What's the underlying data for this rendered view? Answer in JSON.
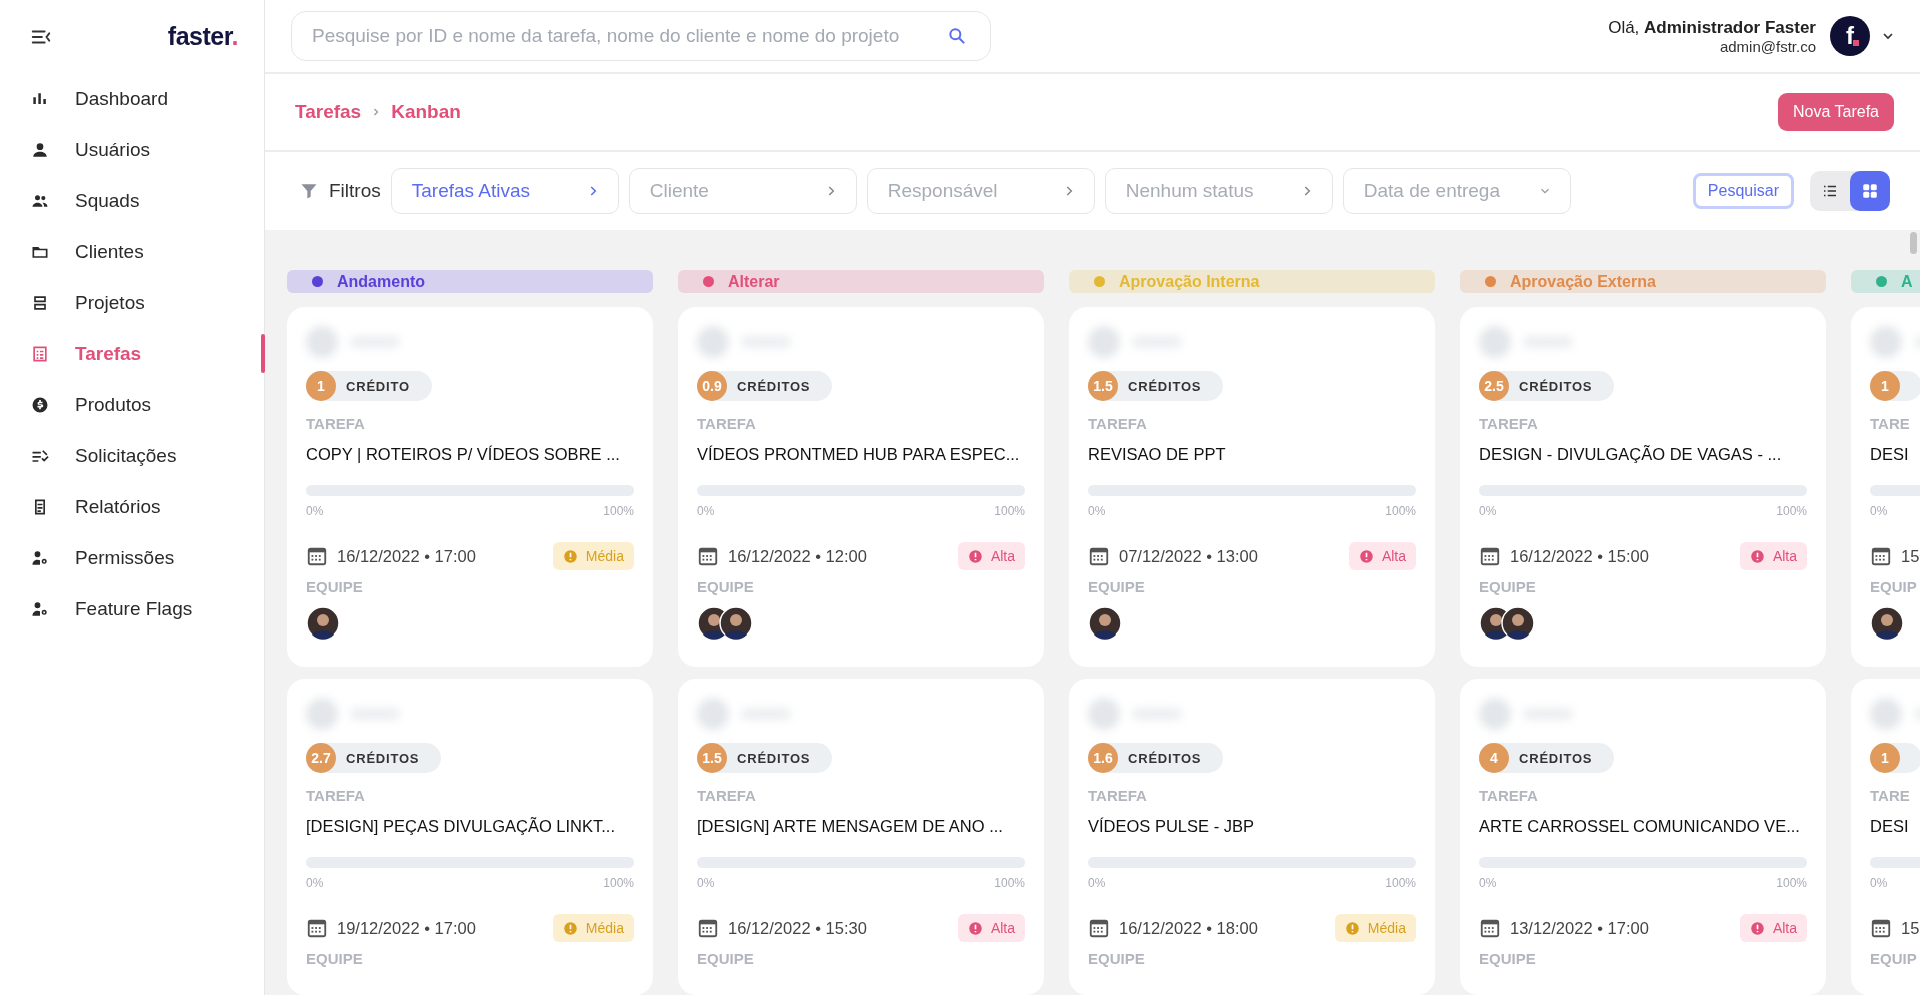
{
  "sidebar": {
    "logo": {
      "text": "faster",
      "mark": "."
    },
    "items": [
      {
        "label": "Dashboard",
        "selected": false
      },
      {
        "label": "Usuários",
        "selected": false
      },
      {
        "label": "Squads",
        "selected": false
      },
      {
        "label": "Clientes",
        "selected": false
      },
      {
        "label": "Projetos",
        "selected": false
      },
      {
        "label": "Tarefas",
        "selected": true
      },
      {
        "label": "Produtos",
        "selected": false
      },
      {
        "label": "Solicitações",
        "selected": false
      },
      {
        "label": "Relatórios",
        "selected": false
      },
      {
        "label": "Permissões",
        "selected": false
      },
      {
        "label": "Feature Flags",
        "selected": false
      }
    ]
  },
  "header": {
    "search": {
      "placeholder": "Pesquise por ID e nome da tarefa, nome do cliente e nome do projeto"
    },
    "greeting": "Olá, **Administrador Faster**",
    "email": "admin@fstr.co",
    "avatar_text": "f"
  },
  "breadcrumb": [
    "Tarefas",
    "Kanban"
  ],
  "new_button": "Nova Tarefa",
  "filters": {
    "label": "Filtros",
    "fields": [
      {
        "label": "Tarefas Ativas",
        "active": true,
        "kind": "select"
      },
      {
        "label": "Cliente",
        "active": false,
        "kind": "select"
      },
      {
        "label": "Responsável",
        "active": false,
        "kind": "select"
      },
      {
        "label": "Nenhum status",
        "active": false,
        "kind": "select"
      },
      {
        "label": "Data de entrega",
        "active": false,
        "kind": "date"
      }
    ],
    "search_button": "Pesquisar",
    "views": [
      {
        "kind": "list",
        "selected": false
      },
      {
        "kind": "grid",
        "selected": true
      }
    ]
  },
  "columns": [
    {
      "title": "Andamento",
      "color": "#5a3fd9",
      "cards": [
        {
          "credits": "1",
          "credits_label": "CRÉDITO",
          "label": "TAREFA",
          "title": "COPY | ROTEIROS P/ VÍDEOS SOBRE ...",
          "level": 0,
          "start": "0%",
          "end": "100%",
          "date": "16/12/2022 • 17:00",
          "priority": {
            "label": "Média",
            "kind": "medium"
          },
          "team_label": "EQUIPE",
          "team": [
            {
              "kind": "photo"
            }
          ]
        },
        {
          "credits": "2.7",
          "credits_label": "CRÉDITOS",
          "label": "TAREFA",
          "title": "[DESIGN] PEÇAS DIVULGAÇÃO LINKT...",
          "level": 0,
          "start": "0%",
          "end": "100%",
          "date": "19/12/2022 • 17:00",
          "priority": {
            "label": "Média",
            "kind": "medium"
          },
          "team_label": "EQUIPE"
        }
      ]
    },
    {
      "title": "Alterar",
      "color": "#e0507a",
      "cards": [
        {
          "credits": "0.9",
          "credits_label": "CRÉDITOS",
          "label": "TAREFA",
          "title": "VÍDEOS PRONTMED HUB PARA ESPEC...",
          "level": 0,
          "start": "0%",
          "end": "100%",
          "date": "16/12/2022 • 12:00",
          "priority": {
            "label": "Alta",
            "kind": "high"
          },
          "team_label": "EQUIPE",
          "team": [
            {
              "kind": "photo"
            },
            {
              "kind": "photo"
            }
          ]
        },
        {
          "credits": "1.5",
          "credits_label": "CRÉDITOS",
          "label": "TAREFA",
          "title": "[DESIGN] ARTE MENSAGEM DE ANO ...",
          "level": 0,
          "start": "0%",
          "end": "100%",
          "date": "16/12/2022 • 15:30",
          "priority": {
            "label": "Alta",
            "kind": "high"
          },
          "team_label": "EQUIPE"
        }
      ]
    },
    {
      "title": "Aprovação Interna",
      "color": "#e3b932",
      "cards": [
        {
          "credits": "1.5",
          "credits_label": "CRÉDITOS",
          "label": "TAREFA",
          "title": "REVISAO DE PPT",
          "level": 0,
          "start": "0%",
          "end": "100%",
          "date": "07/12/2022 • 13:00",
          "priority": {
            "label": "Alta",
            "kind": "high"
          },
          "team_label": "EQUIPE",
          "team": [
            {
              "kind": "photo"
            }
          ]
        },
        {
          "credits": "1.6",
          "credits_label": "CRÉDITOS",
          "label": "TAREFA",
          "title": "VÍDEOS PULSE - JBP",
          "level": 0,
          "start": "0%",
          "end": "100%",
          "date": "16/12/2022 • 18:00",
          "priority": {
            "label": "Média",
            "kind": "medium"
          },
          "team_label": "EQUIPE"
        }
      ]
    },
    {
      "title": "Aprovação Externa",
      "color": "#e08b4c",
      "cards": [
        {
          "credits": "2.5",
          "credits_label": "CRÉDITOS",
          "label": "TAREFA",
          "title": "DESIGN - DIVULGAÇÃO DE VAGAS - ...",
          "level": 0,
          "start": "0%",
          "end": "100%",
          "date": "16/12/2022 • 15:00",
          "priority": {
            "label": "Alta",
            "kind": "high"
          },
          "team_label": "EQUIPE",
          "team": [
            {
              "kind": "photo"
            },
            {
              "kind": "photo"
            }
          ]
        },
        {
          "credits": "4",
          "credits_label": "CRÉDITOS",
          "label": "TAREFA",
          "title": "ARTE CARROSSEL COMUNICANDO VE...",
          "level": 0,
          "start": "0%",
          "end": "100%",
          "date": "13/12/2022 • 17:00",
          "priority": {
            "label": "Alta",
            "kind": "high"
          },
          "team_label": "EQUIPE"
        }
      ]
    },
    {
      "title": "A",
      "color": "#2fb38a",
      "cards": [
        {
          "credits": "1",
          "label": "TARE",
          "title": "DESI",
          "level": 0,
          "start": "0%",
          "date": "15",
          "team_label": "EQUIP",
          "team": [
            {
              "kind": "photo"
            }
          ]
        },
        {
          "credits": "1",
          "label": "TARE",
          "title": "DESI",
          "level": 0,
          "start": "0%",
          "date": "15",
          "team_label": "EQUIP"
        }
      ]
    }
  ]
}
